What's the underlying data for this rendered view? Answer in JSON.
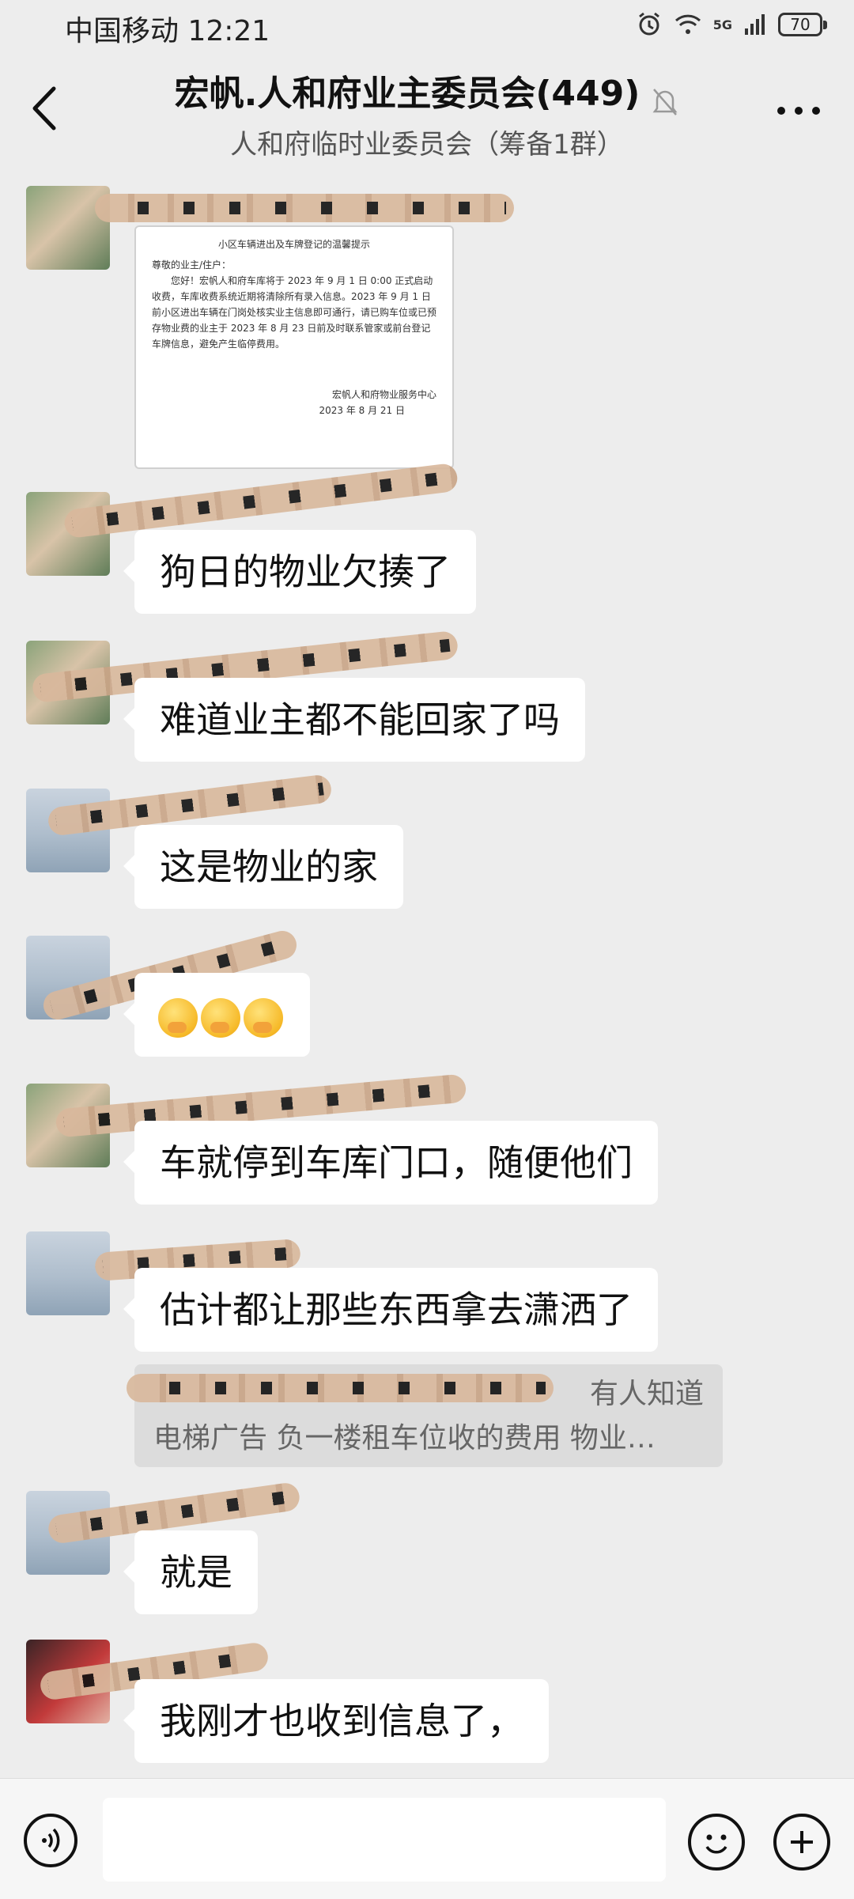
{
  "status_bar": {
    "carrier_time": "中国移动 12:21",
    "battery": "70",
    "network": "5G"
  },
  "header": {
    "title": "宏帆.人和府业主委员会(449)",
    "subtitle": "人和府临时业委员会（筹备1群）"
  },
  "notice": {
    "title": "小区车辆进出及车牌登记的温馨提示",
    "greeting": "尊敬的业主/住户：",
    "body": "您好！宏帆人和府车库将于 2023 年 9 月 1 日 0:00 正式启动收费，车库收费系统近期将清除所有录入信息。2023 年 9 月 1 日前小区进出车辆在门岗处核实业主信息即可通行，请已购车位或已预存物业费的业主于 2023 年 8 月 23 日前及时联系管家或前台登记车牌信息，避免产生临停费用。",
    "signature": "宏帆人和府物业服务中心",
    "date": "2023 年 8 月 21 日"
  },
  "messages": [
    {
      "text": "狗日的物业欠揍了"
    },
    {
      "text": "难道业主都不能回家了吗"
    },
    {
      "text": "这是物业的家"
    },
    {
      "text": ""
    },
    {
      "text": "车就停到车库门口，随便他们"
    },
    {
      "text": "估计都让那些东西拿去潇洒了"
    },
    {
      "text": "就是"
    },
    {
      "text": "我刚才也收到信息了，"
    }
  ],
  "quote": {
    "line1": "有人知道",
    "line2": "电梯广告  负一楼租车位收的费用  物业…"
  },
  "input": {
    "placeholder": ""
  }
}
